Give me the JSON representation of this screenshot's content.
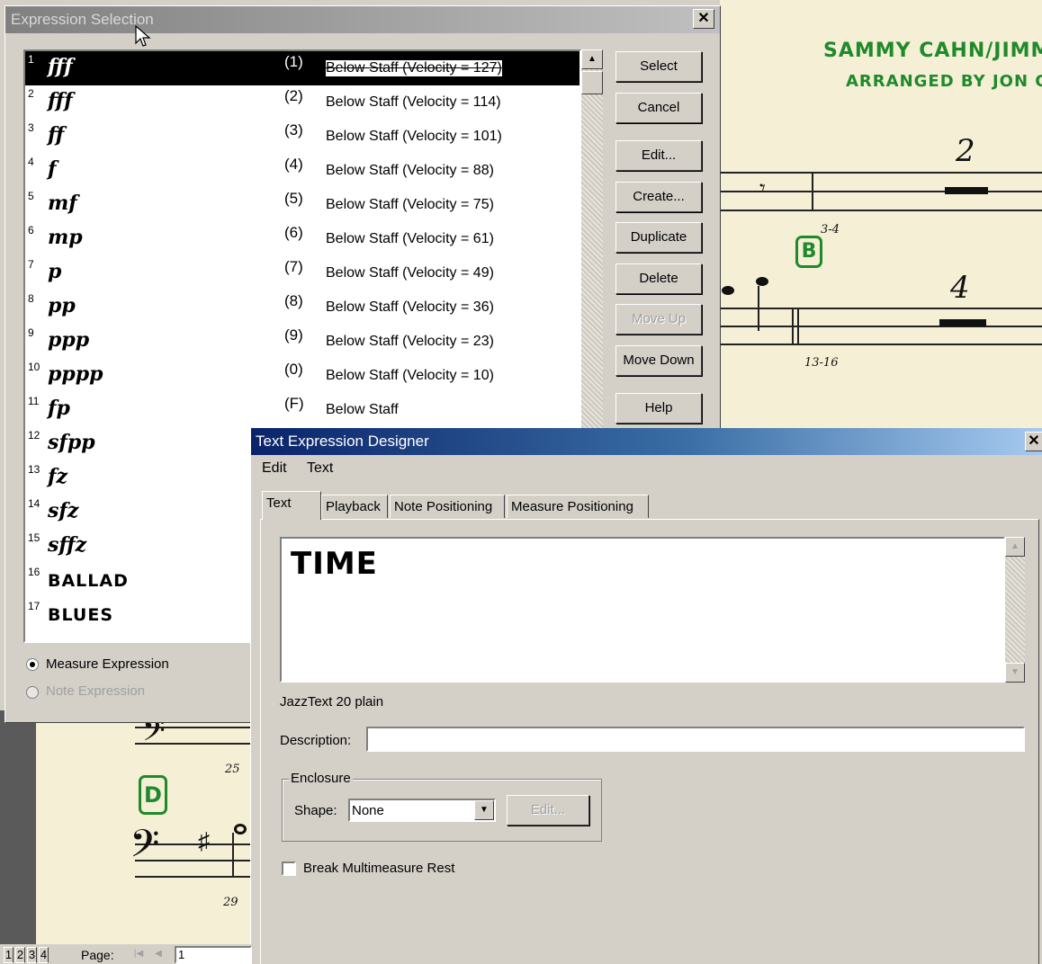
{
  "score": {
    "credit_line1": "SAMMY CAHN/JIMMY VA",
    "credit_line2": "ARRANGED BY JON C.",
    "rehearsal_b": "B",
    "rehearsal_d": "D",
    "measure_num_2": "2",
    "measure_num_4": "4",
    "measure_range_34": "3-4",
    "measure_range_1316": "13-16",
    "measure_25": "25",
    "measure_29": "29"
  },
  "expression_selection": {
    "title": "Expression Selection",
    "close_label": "✕",
    "rows": [
      {
        "idx": "1",
        "glyph": "fff",
        "word": false,
        "key": "(1)",
        "desc": "Below Staff (Velocity = 127)"
      },
      {
        "idx": "2",
        "glyph": "fff",
        "word": false,
        "key": "(2)",
        "desc": "Below Staff (Velocity = 114)"
      },
      {
        "idx": "3",
        "glyph": "ff",
        "word": false,
        "key": "(3)",
        "desc": "Below Staff (Velocity = 101)"
      },
      {
        "idx": "4",
        "glyph": "f",
        "word": false,
        "key": "(4)",
        "desc": "Below Staff (Velocity = 88)"
      },
      {
        "idx": "5",
        "glyph": "mf",
        "word": false,
        "key": "(5)",
        "desc": "Below Staff (Velocity = 75)"
      },
      {
        "idx": "6",
        "glyph": "mp",
        "word": false,
        "key": "(6)",
        "desc": "Below Staff (Velocity = 61)"
      },
      {
        "idx": "7",
        "glyph": "p",
        "word": false,
        "key": "(7)",
        "desc": "Below Staff (Velocity = 49)"
      },
      {
        "idx": "8",
        "glyph": "pp",
        "word": false,
        "key": "(8)",
        "desc": "Below Staff (Velocity = 36)"
      },
      {
        "idx": "9",
        "glyph": "ppp",
        "word": false,
        "key": "(9)",
        "desc": "Below Staff (Velocity = 23)"
      },
      {
        "idx": "10",
        "glyph": "pppp",
        "word": false,
        "key": "(0)",
        "desc": "Below Staff (Velocity = 10)"
      },
      {
        "idx": "11",
        "glyph": "fp",
        "word": false,
        "key": "(F)",
        "desc": "Below Staff"
      },
      {
        "idx": "12",
        "glyph": "sfpp",
        "word": false,
        "key": "",
        "desc": ""
      },
      {
        "idx": "13",
        "glyph": "fz",
        "word": false,
        "key": "",
        "desc": ""
      },
      {
        "idx": "14",
        "glyph": "sfz",
        "word": false,
        "key": "",
        "desc": ""
      },
      {
        "idx": "15",
        "glyph": "sffz",
        "word": false,
        "key": "",
        "desc": ""
      },
      {
        "idx": "16",
        "glyph": "BALLAD",
        "word": true,
        "key": "",
        "desc": ""
      },
      {
        "idx": "17",
        "glyph": "BLUES",
        "word": true,
        "key": "",
        "desc": ""
      }
    ],
    "buttons": {
      "select": "Select",
      "cancel": "Cancel",
      "edit": "Edit...",
      "create": "Create...",
      "duplicate": "Duplicate",
      "delete": "Delete",
      "move_up": "Move Up",
      "move_down": "Move Down",
      "help": "Help"
    },
    "radio_measure": "Measure Expression",
    "radio_note": "Note Expression"
  },
  "designer": {
    "title": "Text Expression Designer",
    "close_label": "✕",
    "menu_edit": "Edit",
    "menu_text": "Text",
    "tabs": {
      "text": "Text",
      "playback": "Playback",
      "note_positioning": "Note Positioning",
      "measure_positioning": "Measure Positioning"
    },
    "text_content": "TIME",
    "font_info": "JazzText 20 plain",
    "description_label": "Description:",
    "description_value": "",
    "enclosure_label": "Enclosure",
    "shape_label": "Shape:",
    "shape_value": "None",
    "enclosure_edit": "Edit...",
    "break_rest_label": "Break Multimeasure Rest"
  },
  "statusbar": {
    "page_tabs": [
      "1",
      "2",
      "3",
      "4"
    ],
    "page_label": "Page:",
    "page_value": "1"
  }
}
